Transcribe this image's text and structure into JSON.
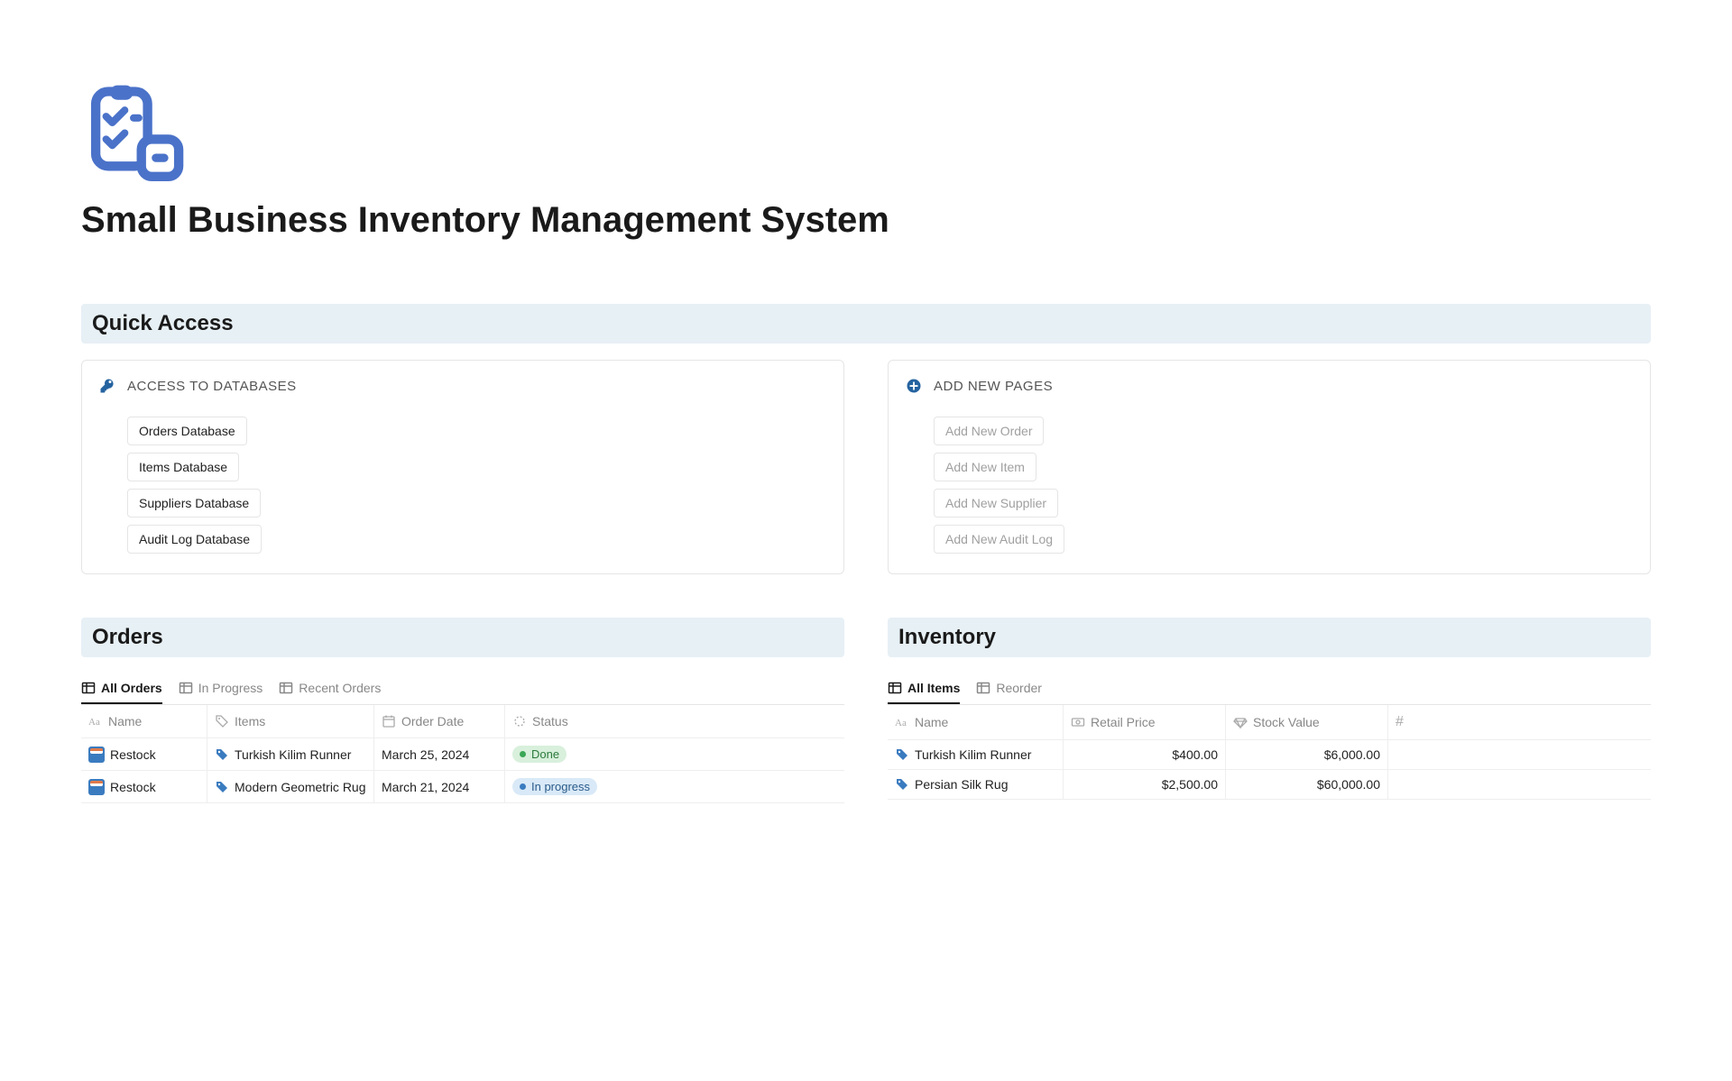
{
  "page": {
    "title": "Small Business Inventory Management System"
  },
  "quick_access": {
    "heading": "Quick Access",
    "databases": {
      "label": "ACCESS TO DATABASES",
      "items": [
        "Orders Database",
        "Items Database",
        "Suppliers Database",
        "Audit Log Database"
      ]
    },
    "add_pages": {
      "label": "ADD NEW PAGES",
      "items": [
        "Add New Order",
        "Add New Item",
        "Add New Supplier",
        "Add New Audit Log"
      ]
    }
  },
  "orders": {
    "heading": "Orders",
    "tabs": [
      "All Orders",
      "In Progress",
      "Recent Orders"
    ],
    "columns": [
      "Name",
      "Items",
      "Order Date",
      "Status"
    ],
    "rows": [
      {
        "name": "Restock",
        "item": "Turkish Kilim Runner",
        "date": "March 25, 2024",
        "status": "Done"
      },
      {
        "name": "Restock",
        "item": "Modern Geometric Rug",
        "date": "March 21, 2024",
        "status": "In progress"
      }
    ]
  },
  "inventory": {
    "heading": "Inventory",
    "tabs": [
      "All Items",
      "Reorder"
    ],
    "columns": [
      "Name",
      "Retail Price",
      "Stock Value",
      "#"
    ],
    "rows": [
      {
        "name": "Turkish Kilim Runner",
        "price": "$400.00",
        "stock": "$6,000.00"
      },
      {
        "name": "Persian Silk Rug",
        "price": "$2,500.00",
        "stock": "$60,000.00"
      }
    ]
  }
}
